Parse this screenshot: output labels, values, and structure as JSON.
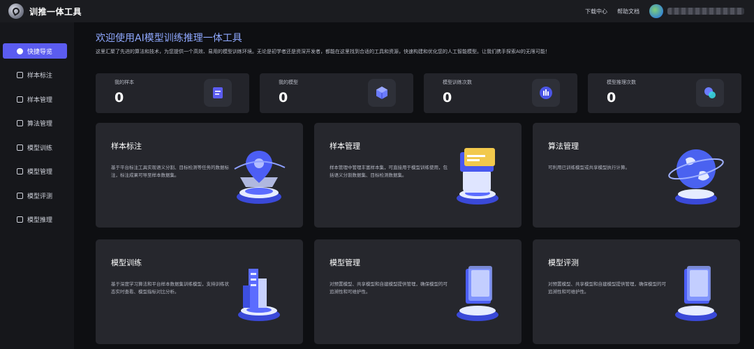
{
  "app": {
    "title": "训推一体工具"
  },
  "header": {
    "links": [
      "下载中心",
      "帮助文档"
    ]
  },
  "sidebar": {
    "items": [
      {
        "label": "快捷导览",
        "icon": "compass-icon"
      },
      {
        "label": "样本标注",
        "icon": "tag-icon"
      },
      {
        "label": "样本管理",
        "icon": "folder-icon"
      },
      {
        "label": "算法管理",
        "icon": "code-icon"
      },
      {
        "label": "模型训练",
        "icon": "gear-icon"
      },
      {
        "label": "模型管理",
        "icon": "cube-icon"
      },
      {
        "label": "模型评测",
        "icon": "chart-icon"
      },
      {
        "label": "模型推理",
        "icon": "brain-icon"
      }
    ]
  },
  "welcome": {
    "title": "欢迎使用AI模型训练推理一体工具",
    "subtitle": "这里汇聚了先进的算法和技术，为您提供一个高效、易用的模型训练环境。无论是初学者还是资深开发者，都能在这里找到合适的工具和资源，快速构建和优化您的人工智能模型。让我们携手探索AI的无限可能！"
  },
  "stats": [
    {
      "label": "我的样本",
      "value": "0",
      "icon": "document-icon"
    },
    {
      "label": "我的模型",
      "value": "0",
      "icon": "cube-icon"
    },
    {
      "label": "模型训练次数",
      "value": "0",
      "icon": "bar-chart-icon"
    },
    {
      "label": "模型推理次数",
      "value": "0",
      "icon": "shapes-icon"
    }
  ],
  "features": [
    {
      "title": "样本标注",
      "desc": "基于平台标注工具实现语义分割、目标检测等任务的数据标注，标注成果可导至样本数据集。",
      "icon": "location-pin-icon"
    },
    {
      "title": "样本管理",
      "desc": "样本管理中管理丰富样本集，可直接用于模型训练使用，包括语义分割数据集、目标检测数据集。",
      "icon": "folder-stack-icon"
    },
    {
      "title": "算法管理",
      "desc": "可利用已训练模型或共享模型执行计算。",
      "icon": "globe-icon"
    },
    {
      "title": "模型训练",
      "desc": "基于深度学习算法和平台样本数据集训练模型，支持训练状态实时查看、模型指标对比分析。",
      "icon": "buildings-icon"
    },
    {
      "title": "模型管理",
      "desc": "对预置模型、共享模型和自建模型提供管理，确保模型的可追溯性和可维护性。",
      "icon": "server-icon"
    },
    {
      "title": "模型评测",
      "desc": "对预置模型、共享模型和自建模型提供管理，确保模型的可追溯性和可维护性。",
      "icon": "server-icon"
    }
  ],
  "colors": {
    "accent": "#5b5cf0",
    "title": "#8fa8ff",
    "card": "#26272d",
    "bg": "#0e0f12"
  }
}
